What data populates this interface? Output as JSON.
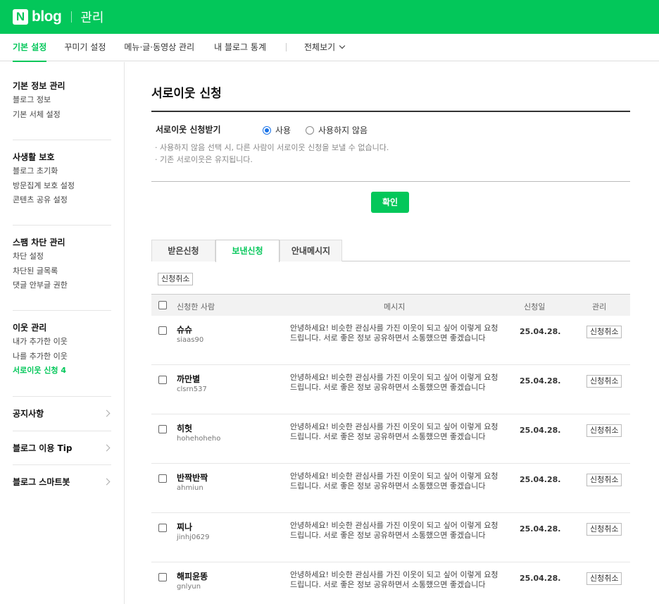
{
  "header": {
    "logo_mark": "N",
    "logo_text": "blog",
    "section_title": "관리"
  },
  "nav": {
    "items": [
      "기본 설정",
      "꾸미기 설정",
      "메뉴·글·동영상 관리",
      "내 블로그 통계"
    ],
    "view_all": "전체보기"
  },
  "sidebar": {
    "groups": [
      {
        "title": "기본 정보 관리",
        "items": [
          "블로그 정보",
          "기본 서체 설정"
        ]
      },
      {
        "title": "사생활 보호",
        "items": [
          "블로그 초기화",
          "방문집계 보호 설정",
          "콘텐츠 공유 설정"
        ]
      },
      {
        "title": "스팸 차단 관리",
        "items": [
          "차단 설정",
          "차단된 글목록",
          "댓글 안부글 권한"
        ]
      },
      {
        "title": "이웃 관리",
        "items": [
          "내가 추가한 이웃",
          "나를 추가한 이웃",
          "서로이웃 신청 4"
        ]
      }
    ],
    "links": [
      "공지사항",
      "블로그 이용 Tip",
      "블로그 스마트봇"
    ]
  },
  "main": {
    "title": "서로이웃 신청",
    "option_label": "서로이웃 신청받기",
    "radio_use": "사용",
    "radio_not_use": "사용하지 않음",
    "notes": [
      "· 사용하지 않음 선택 시, 다른 사람이 서로이웃 신청을 보낼 수 없습니다.",
      "· 기존 서로이웃은 유지됩니다."
    ],
    "confirm_label": "확인",
    "tabs": [
      "받은신청",
      "보낸신청",
      "안내메시지"
    ],
    "cancel_all_label": "신청취소",
    "table": {
      "headers": [
        "신청한 사람",
        "메시지",
        "신청일",
        "관리"
      ],
      "rows": [
        {
          "nick": "슈슈",
          "id": "siaas90",
          "message": "안녕하세요! 비슷한 관심사를 가진 이웃이 되고 싶어 이렇게 요청 드립니다. 서로 좋은 정보 공유하면서 소통했으면 좋겠습니다",
          "date": "25.04.28.",
          "action": "신청취소"
        },
        {
          "nick": "까만별",
          "id": "clsrn537",
          "message": "안녕하세요! 비슷한 관심사를 가진 이웃이 되고 싶어 이렇게 요청 드립니다. 서로 좋은 정보 공유하면서 소통했으면 좋겠습니다",
          "date": "25.04.28.",
          "action": "신청취소"
        },
        {
          "nick": "히헛",
          "id": "hohehoheho",
          "message": "안녕하세요! 비슷한 관심사를 가진 이웃이 되고 싶어 이렇게 요청 드립니다. 서로 좋은 정보 공유하면서 소통했으면 좋겠습니다",
          "date": "25.04.28.",
          "action": "신청취소"
        },
        {
          "nick": "반짝반짝",
          "id": "ahmiun",
          "message": "안녕하세요! 비슷한 관심사를 가진 이웃이 되고 싶어 이렇게 요청 드립니다. 서로 좋은 정보 공유하면서 소통했으면 좋겠습니다",
          "date": "25.04.28.",
          "action": "신청취소"
        },
        {
          "nick": "찌나",
          "id": "jinhj0629",
          "message": "안녕하세요! 비슷한 관심사를 가진 이웃이 되고 싶어 이렇게 요청 드립니다. 서로 좋은 정보 공유하면서 소통했으면 좋겠습니다",
          "date": "25.04.28.",
          "action": "신청취소"
        },
        {
          "nick": "해피윤똥",
          "id": "gnlyun",
          "message": "안녕하세요! 비슷한 관심사를 가진 이웃이 되고 싶어 이렇게 요청 드립니다. 서로 좋은 정보 공유하면서 소통했으면 좋겠습니다",
          "date": "25.04.28.",
          "action": "신청취소"
        }
      ]
    }
  },
  "colors": {
    "brand_green": "#03c75a",
    "radio_blue": "#1a73e8"
  }
}
